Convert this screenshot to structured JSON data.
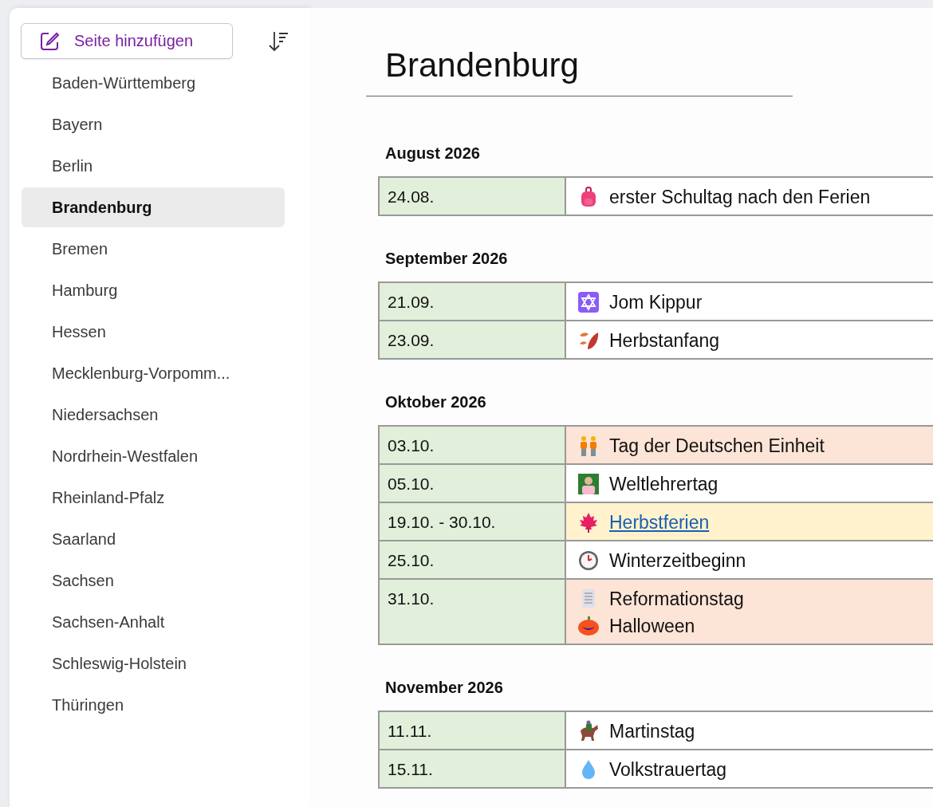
{
  "sidebar": {
    "add_button": {
      "label": "Seite hinzufügen"
    },
    "items": [
      {
        "label": "Baden-Württemberg",
        "selected": false
      },
      {
        "label": "Bayern",
        "selected": false
      },
      {
        "label": "Berlin",
        "selected": false
      },
      {
        "label": "Brandenburg",
        "selected": true
      },
      {
        "label": "Bremen",
        "selected": false
      },
      {
        "label": "Hamburg",
        "selected": false
      },
      {
        "label": "Hessen",
        "selected": false
      },
      {
        "label": "Mecklenburg-Vorpomm...",
        "selected": false
      },
      {
        "label": "Niedersachsen",
        "selected": false
      },
      {
        "label": "Nordrhein-Westfalen",
        "selected": false
      },
      {
        "label": "Rheinland-Pfalz",
        "selected": false
      },
      {
        "label": "Saarland",
        "selected": false
      },
      {
        "label": "Sachsen",
        "selected": false
      },
      {
        "label": "Sachsen-Anhalt",
        "selected": false
      },
      {
        "label": "Schleswig-Holstein",
        "selected": false
      },
      {
        "label": "Thüringen",
        "selected": false
      }
    ]
  },
  "page": {
    "title": "Brandenburg",
    "months": [
      {
        "heading": "August 2026",
        "rows": [
          {
            "date": "24.08.",
            "color": "#ffffff",
            "events": [
              {
                "kind": "backpack",
                "text": "erster Schultag nach den Ferien"
              }
            ]
          }
        ]
      },
      {
        "heading": "September 2026",
        "rows": [
          {
            "date": "21.09.",
            "color": "#ffffff",
            "events": [
              {
                "kind": "star",
                "text": "Jom Kippur"
              }
            ]
          },
          {
            "date": "23.09.",
            "color": "#ffffff",
            "events": [
              {
                "kind": "leaves",
                "text": "Herbstanfang"
              }
            ]
          }
        ]
      },
      {
        "heading": "Oktober 2026",
        "rows": [
          {
            "date": "03.10.",
            "color": "#fce4d6",
            "events": [
              {
                "kind": "people",
                "text": "Tag der Deutschen Einheit"
              }
            ]
          },
          {
            "date": "05.10.",
            "color": "#ffffff",
            "events": [
              {
                "kind": "teacher",
                "text": "Weltlehrertag"
              }
            ]
          },
          {
            "date": "19.10. - 30.10.",
            "color": "#fff2cc",
            "events": [
              {
                "kind": "maple",
                "text": "Herbstferien",
                "link": true
              }
            ]
          },
          {
            "date": "25.10.",
            "color": "#ffffff",
            "events": [
              {
                "kind": "clock",
                "text": "Winterzeitbeginn"
              }
            ]
          },
          {
            "date": "31.10.",
            "color": "#fce4d6",
            "events": [
              {
                "kind": "scroll",
                "text": "Reformationstag"
              },
              {
                "kind": "pumpkin",
                "text": "Halloween"
              }
            ]
          }
        ]
      },
      {
        "heading": "November 2026",
        "rows": [
          {
            "date": "11.11.",
            "color": "#ffffff",
            "events": [
              {
                "kind": "horse",
                "text": "Martinstag"
              }
            ]
          },
          {
            "date": "15.11.",
            "color": "#ffffff",
            "events": [
              {
                "kind": "drop",
                "text": "Volkstrauertag"
              }
            ]
          }
        ]
      }
    ]
  }
}
